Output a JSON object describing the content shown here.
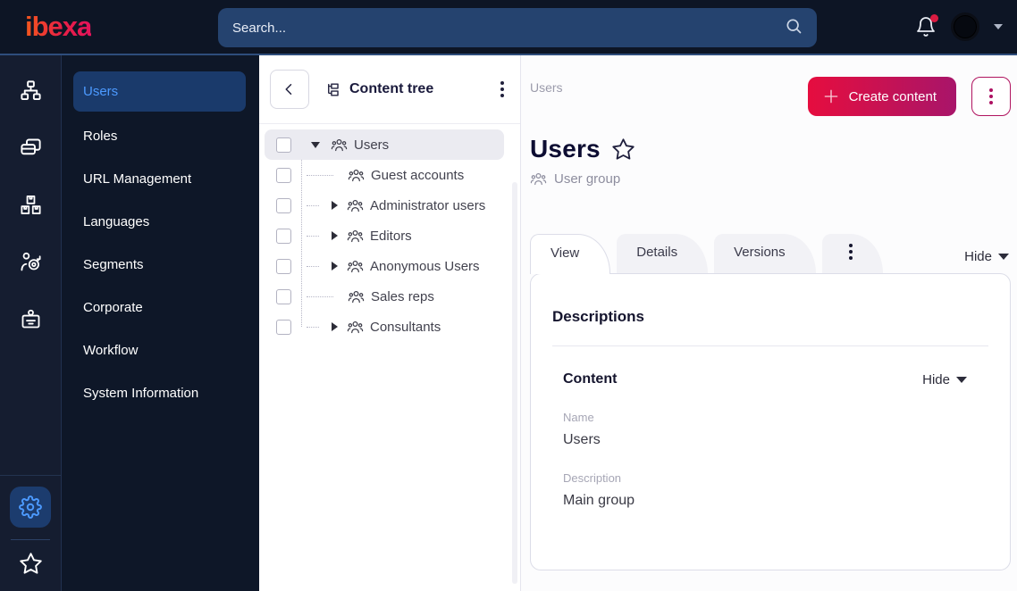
{
  "topbar": {
    "logo_text": "ibexa",
    "search_placeholder": "Search..."
  },
  "rail": {
    "icons": [
      "sitemap-icon",
      "pages-icon",
      "boxes-icon",
      "customer-target-icon",
      "badge-icon"
    ],
    "bottom_icons": [
      "settings-gear-icon",
      "bookmarks-star-icon"
    ],
    "active_icon": "settings-gear-icon"
  },
  "menu": {
    "items": [
      {
        "label": "Users",
        "active": true
      },
      {
        "label": "Roles",
        "active": false
      },
      {
        "label": "URL Management",
        "active": false
      },
      {
        "label": "Languages",
        "active": false
      },
      {
        "label": "Segments",
        "active": false
      },
      {
        "label": "Corporate",
        "active": false
      },
      {
        "label": "Workflow",
        "active": false
      },
      {
        "label": "System Information",
        "active": false
      }
    ]
  },
  "tree_panel": {
    "title": "Content tree",
    "items": [
      {
        "label": "Users",
        "expander": "expanded",
        "selected": true,
        "level": 0
      },
      {
        "label": "Guest accounts",
        "expander": "none",
        "selected": false,
        "level": 1
      },
      {
        "label": "Administrator users",
        "expander": "collapsed",
        "selected": false,
        "level": 1
      },
      {
        "label": "Editors",
        "expander": "collapsed",
        "selected": false,
        "level": 1
      },
      {
        "label": "Anonymous Users",
        "expander": "collapsed",
        "selected": false,
        "level": 1
      },
      {
        "label": "Sales reps",
        "expander": "none",
        "selected": false,
        "level": 1
      },
      {
        "label": "Consultants",
        "expander": "collapsed",
        "selected": false,
        "level": 1
      }
    ]
  },
  "main": {
    "breadcrumb": "Users",
    "create_button_label": "Create content",
    "page_title": "Users",
    "content_type": "User group",
    "tabs": [
      {
        "label": "View",
        "active": true
      },
      {
        "label": "Details",
        "active": false
      },
      {
        "label": "Versions",
        "active": false
      }
    ],
    "tabs_hide_label": "Hide",
    "card": {
      "section_title": "Descriptions",
      "subsection_title": "Content",
      "subsection_hide_label": "Hide",
      "fields": [
        {
          "label": "Name",
          "value": "Users"
        },
        {
          "label": "Description",
          "value": "Main group"
        }
      ]
    }
  },
  "colors": {
    "topbar_bg": "#0d1525",
    "rail_bg": "#151d30",
    "menu_bg": "#0e1728",
    "active_item_bg": "#1a3a6b",
    "accent_blue": "#4c9aff",
    "search_bg": "#25436f",
    "brand_gradient_start": "#f4581d",
    "brand_gradient_end": "#e4135b",
    "button_gradient_start": "#e60d3f",
    "button_gradient_end": "#a8156a",
    "crimson": "#ad1162",
    "notification_dot": "#da1b41",
    "selected_row_bg": "#ebebf1",
    "card_border": "#dcdde8"
  }
}
